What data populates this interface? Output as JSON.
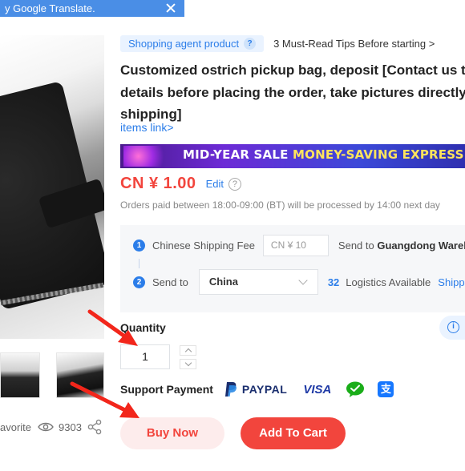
{
  "translate_banner": {
    "text": "y Google Translate."
  },
  "gallery": {
    "stats_label": "avorite",
    "view_count": "9303"
  },
  "product": {
    "agent_tag": "Shopping agent product",
    "agent_help": "?",
    "tips_link": "3 Must-Read Tips Before starting >",
    "title_lines": [
      "Customized ostrich pickup bag, deposit [Contact us to",
      "details before placing the order, take pictures directly",
      "shipping]"
    ],
    "items_link": "items link>"
  },
  "promo": {
    "text_a": "MID-YEAR SALE",
    "text_b": "MONEY-SAVING EXPRESS"
  },
  "price": {
    "value": "CN ¥ 1.00",
    "edit": "Edit",
    "help": "?",
    "order_note": "Orders paid between 18:00-09:00 (BT) will be processed by 14:00 next day"
  },
  "shipping": {
    "step1": "1",
    "step2": "2",
    "fee_label": "Chinese Shipping Fee",
    "fee_value": "CN ¥ 10",
    "send_to_label": "Send to",
    "warehouse": "Guangdong Wareho",
    "send_to_label2": "Send to",
    "country": "China",
    "logistics_count": "32",
    "logistics_label": "Logistics Available",
    "shipping_link": "Shippin"
  },
  "quantity": {
    "label": "Quantity",
    "value": "1",
    "info": "i"
  },
  "payment": {
    "label": "Support Payment",
    "paypal": "PAYPAL",
    "visa": "VISA",
    "alipay": "支",
    "methods_icons": [
      "paypal-icon",
      "visa-icon",
      "wechat-pay-icon",
      "alipay-icon"
    ]
  },
  "actions": {
    "buy_now": "Buy Now",
    "add_to_cart": "Add To Cart"
  },
  "colors": {
    "accent_red": "#f2453d",
    "link_blue": "#2b7de9",
    "banner_blue": "#4a8ee6"
  }
}
